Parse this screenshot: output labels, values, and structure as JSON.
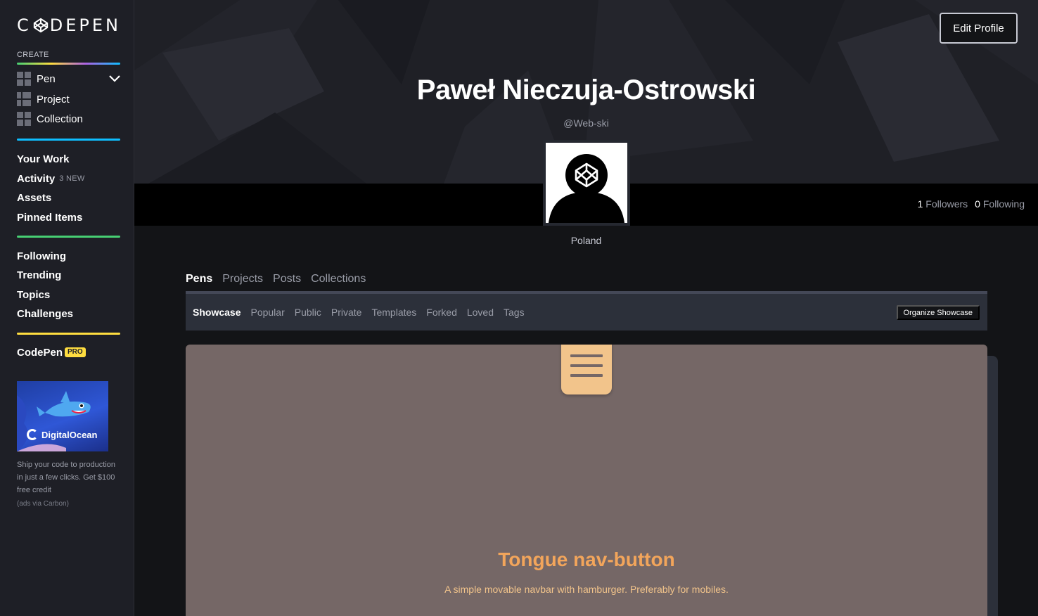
{
  "brand": {
    "logo_left": "C",
    "logo_right": "DEPEN"
  },
  "sidebar": {
    "create_label": "CREATE",
    "create_items": [
      {
        "label": "Pen",
        "icon": "pen-grid-icon"
      },
      {
        "label": "Project",
        "icon": "project-grid-icon"
      },
      {
        "label": "Collection",
        "icon": "collection-grid-icon"
      }
    ],
    "work_items": [
      {
        "label": "Your Work"
      },
      {
        "label": "Activity",
        "badge": "3 NEW"
      },
      {
        "label": "Assets"
      },
      {
        "label": "Pinned Items"
      }
    ],
    "discover_items": [
      {
        "label": "Following"
      },
      {
        "label": "Trending"
      },
      {
        "label": "Topics"
      },
      {
        "label": "Challenges"
      }
    ],
    "pro": {
      "label": "CodePen",
      "badge": "PRO"
    },
    "ad": {
      "brand": "DigitalOcean",
      "text": "Ship your code to production in just a few clicks. Get $100 free credit",
      "via": "(ads via Carbon)"
    },
    "divider_colors": [
      "#0ebeff",
      "#47cf73",
      "#ffdd40"
    ]
  },
  "profile": {
    "edit_label": "Edit Profile",
    "name": "Paweł Nieczuja-Ostrowski",
    "handle": "@Web-ski",
    "followers_count": "1",
    "followers_label": "Followers",
    "following_count": "0",
    "following_label": "Following",
    "location": "Poland"
  },
  "tabs": [
    "Pens",
    "Projects",
    "Posts",
    "Collections"
  ],
  "active_tab": "Pens",
  "subtabs": [
    "Showcase",
    "Popular",
    "Public",
    "Private",
    "Templates",
    "Forked",
    "Loved",
    "Tags"
  ],
  "active_subtab": "Showcase",
  "organize_label": "Organize Showcase",
  "showcase": {
    "title": "Tongue nav-button",
    "subtitle": "A simple movable navbar with hamburger. Preferably for mobiles."
  }
}
